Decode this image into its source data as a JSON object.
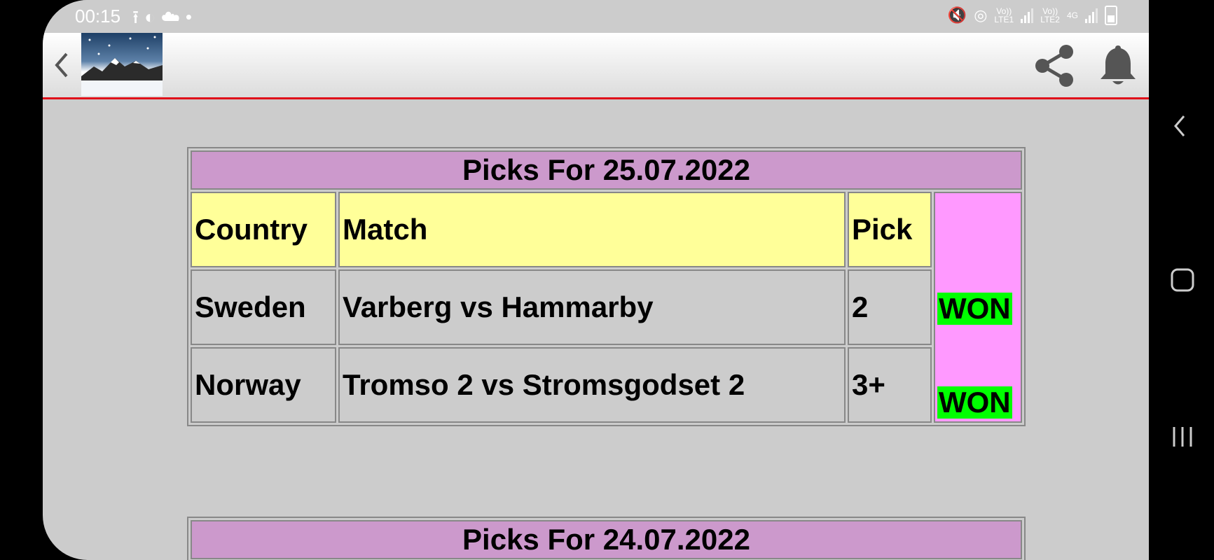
{
  "status_bar": {
    "time": "00:15",
    "left_icons": [
      "upload-icon",
      "app-icon",
      "app-icon",
      "dot-icon"
    ],
    "sim1": {
      "top": "Vo))",
      "bottom": "LTE1"
    },
    "sim2": {
      "top": "Vo))",
      "bottom": "LTE2"
    },
    "network": "4G"
  },
  "app_bar": {
    "back_icon": "chevron-left-icon",
    "logo": "snowy-mountain-logo",
    "share_icon": "share-icon",
    "bell_icon": "bell-icon"
  },
  "tables": [
    {
      "title": "Picks For 25.07.2022",
      "headers": {
        "country": "Country",
        "match": "Match",
        "pick": "Pick"
      },
      "rows": [
        {
          "country": "Sweden",
          "match": "Varberg vs Hammarby",
          "pick": "2"
        },
        {
          "country": "Norway",
          "match": "Tromso 2 vs Stromsgodset 2",
          "pick": "3+"
        }
      ],
      "results": [
        "WON",
        "WON"
      ]
    },
    {
      "title": "Picks For 24.07.2022"
    }
  ],
  "colors": {
    "title_bg": "#cc99cc",
    "header_bg": "#ffff99",
    "result_col_bg": "#ff99ff",
    "won_bg": "#00ff00",
    "appbar_border": "#e0101a"
  },
  "nav_bar": [
    "back-icon",
    "home-icon",
    "recents-icon"
  ]
}
